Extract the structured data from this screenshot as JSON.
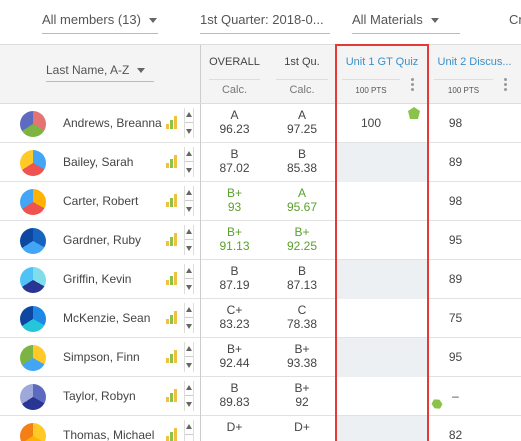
{
  "filters": {
    "members": "All members (13)",
    "quarter": "1st Quarter: 2018-0...",
    "materials": "All Materials",
    "extra": "Cr"
  },
  "header": {
    "sort_label": "Last Name, A-Z",
    "overall": {
      "title": "OVERALL",
      "sub": "Calc."
    },
    "quarter": {
      "title": "1st Qu.",
      "sub": "Calc."
    },
    "unit1": {
      "title": "Unit 1 GT Quiz",
      "pts": "100 PTS"
    },
    "unit2": {
      "title": "Unit 2 Discus...",
      "pts": "100 PTS"
    }
  },
  "students": [
    {
      "name": "Andrews, Breanna",
      "overall_grade": "A",
      "overall_value": "96.23",
      "overall_green": false,
      "q1_grade": "A",
      "q1_value": "97.25",
      "q1_green": false,
      "unit1": "100",
      "unit1_gray": false,
      "unit2": "98",
      "avatar": [
        "#e57373",
        "#7cb342",
        "#5c6bc0"
      ]
    },
    {
      "name": "Bailey, Sarah",
      "overall_grade": "B",
      "overall_value": "87.02",
      "overall_green": false,
      "q1_grade": "B",
      "q1_value": "85.38",
      "q1_green": false,
      "unit1": "",
      "unit1_gray": true,
      "unit2": "89",
      "avatar": [
        "#42a5f5",
        "#ef5350",
        "#ffca28"
      ]
    },
    {
      "name": "Carter, Robert",
      "overall_grade": "B+",
      "overall_value": "93",
      "overall_green": true,
      "q1_grade": "A",
      "q1_value": "95.67",
      "q1_green": true,
      "unit1": "",
      "unit1_gray": false,
      "unit2": "98",
      "avatar": [
        "#ffb300",
        "#ef5350",
        "#42a5f5"
      ]
    },
    {
      "name": "Gardner, Ruby",
      "overall_grade": "B+",
      "overall_value": "91.13",
      "overall_green": true,
      "q1_grade": "B+",
      "q1_value": "92.25",
      "q1_green": true,
      "unit1": "",
      "unit1_gray": false,
      "unit2": "95",
      "avatar": [
        "#1565c0",
        "#42a5f5",
        "#0d47a1"
      ]
    },
    {
      "name": "Griffin, Kevin",
      "overall_grade": "B",
      "overall_value": "87.19",
      "overall_green": false,
      "q1_grade": "B",
      "q1_value": "87.13",
      "q1_green": false,
      "unit1": "",
      "unit1_gray": true,
      "unit2": "89",
      "avatar": [
        "#80deea",
        "#283593",
        "#4fc3f7"
      ]
    },
    {
      "name": "McKenzie, Sean",
      "overall_grade": "C+",
      "overall_value": "83.23",
      "overall_green": false,
      "q1_grade": "C",
      "q1_value": "78.38",
      "q1_green": false,
      "unit1": "",
      "unit1_gray": false,
      "unit2": "75",
      "avatar": [
        "#1e88e5",
        "#26c6da",
        "#0d47a1"
      ]
    },
    {
      "name": "Simpson, Finn",
      "overall_grade": "B+",
      "overall_value": "92.44",
      "overall_green": false,
      "q1_grade": "B+",
      "q1_value": "93.38",
      "q1_green": false,
      "unit1": "",
      "unit1_gray": true,
      "unit2": "95",
      "avatar": [
        "#ffca28",
        "#42a5f5",
        "#7cb342"
      ]
    },
    {
      "name": "Taylor, Robyn",
      "overall_grade": "B",
      "overall_value": "89.83",
      "overall_green": false,
      "q1_grade": "B+",
      "q1_value": "92",
      "q1_green": false,
      "unit1": "",
      "unit1_gray": false,
      "unit2": "–",
      "avatar": [
        "#5c6bc0",
        "#283593",
        "#9fa8da"
      ]
    },
    {
      "name": "Thomas, Michael",
      "overall_grade": "D+",
      "overall_value": "",
      "overall_green": false,
      "q1_grade": "D+",
      "q1_value": "",
      "q1_green": false,
      "unit1": "",
      "unit1_gray": true,
      "unit2": "82",
      "avatar": [
        "#ffca28",
        "#ffb300",
        "#f57f17"
      ]
    }
  ],
  "colors": {
    "accent": "#3a8fc9",
    "highlight": "#e53935",
    "good_grade": "#5aa02c"
  }
}
